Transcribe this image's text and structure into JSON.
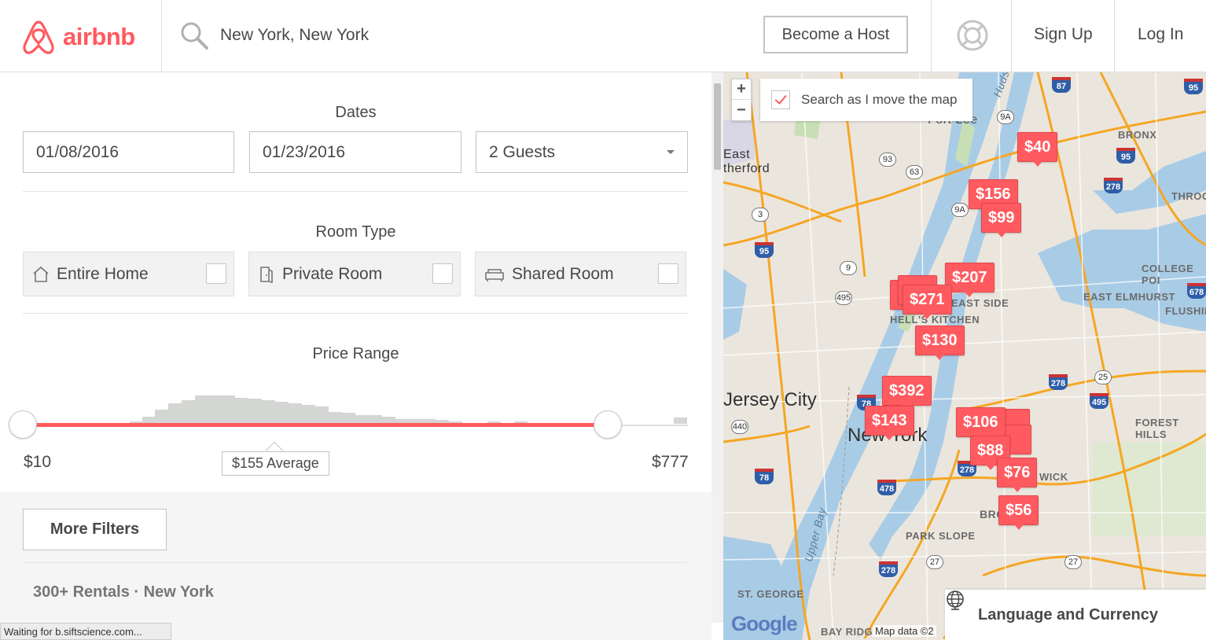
{
  "header": {
    "logo_text": "airbnb",
    "search_value": "New York, New York",
    "become_host": "Become a Host",
    "sign_up": "Sign Up",
    "log_in": "Log In"
  },
  "filters": {
    "dates_title": "Dates",
    "checkin": "01/08/2016",
    "checkout": "01/23/2016",
    "guests": "2 Guests",
    "room_type_title": "Room Type",
    "room_types": [
      {
        "label": "Entire Home",
        "checked": false
      },
      {
        "label": "Private Room",
        "checked": false
      },
      {
        "label": "Shared Room",
        "checked": false
      }
    ],
    "price_title": "Price Range",
    "price_min": "$10",
    "price_max": "$777",
    "price_avg": "$155 Average",
    "more_filters": "More Filters",
    "results": "300+ Rentals · New York"
  },
  "map": {
    "search_as_move": "Search as I move the map",
    "search_as_move_checked": true,
    "zoom_in": "+",
    "zoom_out": "−",
    "markers": [
      "$40",
      "$156",
      "$99",
      "$207",
      "$271",
      "$130",
      "$392",
      "$143",
      "$106",
      "$88",
      "$76",
      "$56"
    ],
    "labels": {
      "fort_lee": "Fort Lee",
      "east_rutherford": "East therford",
      "bronx": "BRONX",
      "college_point": "COLLEGE POI",
      "east_elmhurst": "EAST ELMHURST",
      "flushing": "FLUSHIN",
      "throgs": "THROG",
      "hells_kitchen": "HELL'S KITCHEN",
      "upper_east_side": "EAST SIDE",
      "jersey_city": "Jersey City",
      "new_york": "New York",
      "forest_hills": "FOREST HILLS",
      "bushwick": "WICK",
      "brooklyn": "BROO",
      "park_slope": "PARK SLOPE",
      "upper_bay": "Upper Bay",
      "st_george": "ST. GEORGE",
      "bay_ridge": "BAY RIDG",
      "hudson": "Hudso"
    },
    "attribution_logo": "Google",
    "attribution": "Map data ©2",
    "language_currency": "Language and Currency"
  },
  "status": "Waiting for b.siftscience.com...",
  "colors": {
    "brand": "#ff5a5f",
    "text": "#484848"
  }
}
